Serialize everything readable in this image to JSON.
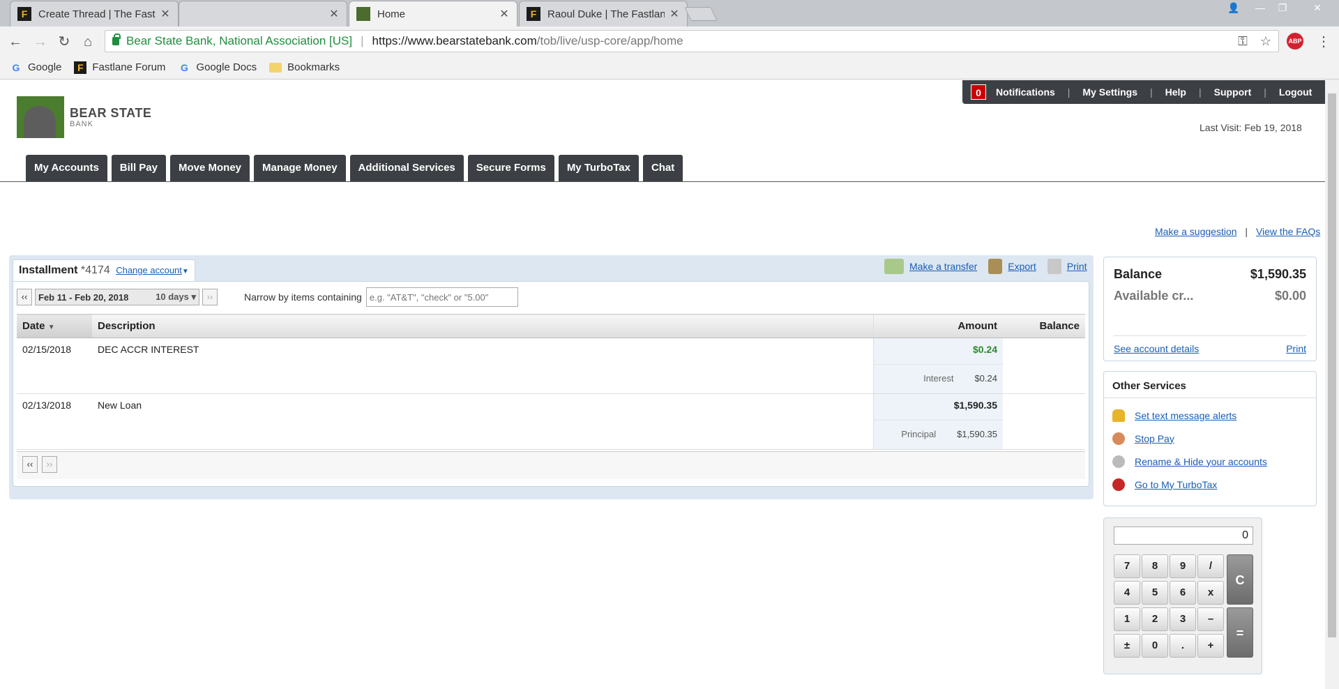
{
  "browser": {
    "tabs": [
      {
        "title": "Create Thread | The Fastlane",
        "icon": "fastlane-favicon"
      },
      {
        "title": "",
        "icon": ""
      },
      {
        "title": "Home",
        "icon": "bear-state-favicon"
      },
      {
        "title": "Raoul Duke | The Fastlane",
        "icon": "fastlane-favicon"
      }
    ],
    "secure_name": "Bear State Bank, National Association [US]",
    "url_host": "https://www.bearstatebank.com",
    "url_path": "/tob/live/usp-core/app/home",
    "bookmarks": [
      {
        "label": "Google",
        "icon": "google-icon"
      },
      {
        "label": "Fastlane Forum",
        "icon": "fastlane-icon"
      },
      {
        "label": "Google Docs",
        "icon": "google-icon"
      },
      {
        "label": "Bookmarks",
        "icon": "folder-icon"
      }
    ]
  },
  "topnav": {
    "notification_count": "0",
    "items": [
      "Notifications",
      "My Settings",
      "Help",
      "Support",
      "Logout"
    ]
  },
  "logo": {
    "title": "BEAR STATE",
    "subtitle": "BANK"
  },
  "last_visit": "Last Visit: Feb 19, 2018",
  "mainnav": [
    "My Accounts",
    "Bill Pay",
    "Move Money",
    "Manage Money",
    "Additional Services",
    "Secure Forms",
    "My TurboTax",
    "Chat"
  ],
  "helplinks": {
    "suggestion": "Make a suggestion",
    "divider": "|",
    "faqs": "View the FAQs"
  },
  "account": {
    "type": "Installment",
    "number": "*4174",
    "change": "Change account",
    "actions": {
      "transfer": "Make a transfer",
      "export": "Export",
      "print": "Print"
    },
    "filter": {
      "prev": "‹‹",
      "next": "››",
      "range": "Feb 11 - Feb 20, 2018",
      "days": "10 days",
      "narrow_label": "Narrow by items containing",
      "placeholder": "e.g. \"AT&T\", \"check\" or \"5.00\""
    },
    "columns": {
      "date": "Date",
      "description": "Description",
      "amount": "Amount",
      "balance": "Balance"
    },
    "transactions": [
      {
        "date": "02/15/2018",
        "description": "DEC ACCR INTEREST",
        "amount": "$0.24",
        "sub_label": "Interest",
        "sub_amount": "$0.24"
      },
      {
        "date": "02/13/2018",
        "description": "New Loan",
        "amount": "$1,590.35",
        "sub_label": "Principal",
        "sub_amount": "$1,590.35"
      }
    ]
  },
  "balance_card": {
    "balance_label": "Balance",
    "balance_value": "$1,590.35",
    "available_label": "Available cr...",
    "available_value": "$0.00",
    "details_link": "See account details",
    "print_link": "Print"
  },
  "other_services": {
    "title": "Other Services",
    "items": [
      "Set text message alerts",
      "Stop Pay",
      "Rename & Hide your accounts",
      "Go to My TurboTax"
    ]
  },
  "calculator": {
    "display": "0",
    "keys": [
      "7",
      "8",
      "9",
      "/",
      "4",
      "5",
      "6",
      "x",
      "1",
      "2",
      "3",
      "–",
      "±",
      "0",
      ".",
      "+"
    ],
    "clear": "C",
    "equals": "="
  }
}
